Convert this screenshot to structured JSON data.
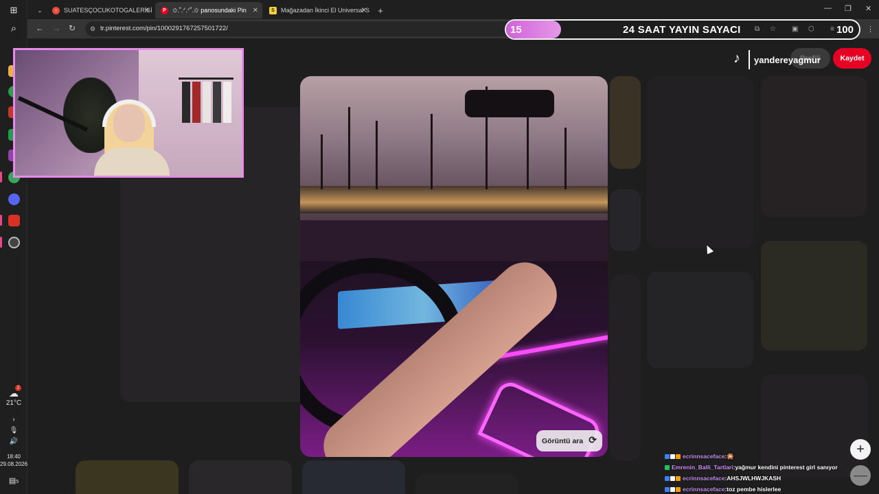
{
  "browser": {
    "tabs": [
      {
        "title": "SUATESÇOCUKOTOGALERİSİ M",
        "favicon_color": "#e74c3c",
        "favicon_glyph": "○"
      },
      {
        "title": "✩.˚.ᐟ.ᐟ˚.✩ panosundaki Pin",
        "favicon_color": "#e60023",
        "favicon_glyph": "P"
      },
      {
        "title": "Mağazadan İkinci El Universal S",
        "favicon_color": "#f4d03f",
        "favicon_glyph": "S"
      }
    ],
    "new_tab_glyph": "+",
    "url": "tr.pinterest.com/pin/1000291767257501722/"
  },
  "counter": {
    "left_value": "15",
    "title": "24 SAAT YAYIN SAYACI",
    "right_value": "100"
  },
  "pinterest": {
    "profile_label": "Profili",
    "save_label": "Kaydet",
    "visual_search_label": "Görüntü ara"
  },
  "tiktok": {
    "username": "yandereyagmur"
  },
  "taskbar": {
    "temperature": "21°C",
    "weather_badge": "2",
    "time": "18:40",
    "date": "29.08.2026",
    "notifications": "5"
  },
  "chat": [
    {
      "user": "ecrinnsaceface",
      "sep": " :",
      "message": " 🎇",
      "badge_colors": [
        "#3b82f6",
        "#ffffff",
        "#f59e0b"
      ]
    },
    {
      "user": "Emrenin_Balli_Tartlari",
      "sep": " :",
      "message": " yağmur kendini pinterest girl sanıyor",
      "badge_colors": [
        "#22c55e"
      ]
    },
    {
      "user": "ecrinnsaceface",
      "sep": " :",
      "message": " AHSJWLHWJKASH",
      "badge_colors": [
        "#3b82f6",
        "#ffffff",
        "#f59e0b"
      ]
    },
    {
      "user": "ecrinnsaceface",
      "sep": " :",
      "message": " toz pembe hislerlee",
      "badge_colors": [
        "#3b82f6",
        "#ffffff",
        "#f59e0b"
      ]
    }
  ],
  "colors": {
    "overlay_accent": "#e58ce8",
    "pinterest_red": "#e60023"
  }
}
